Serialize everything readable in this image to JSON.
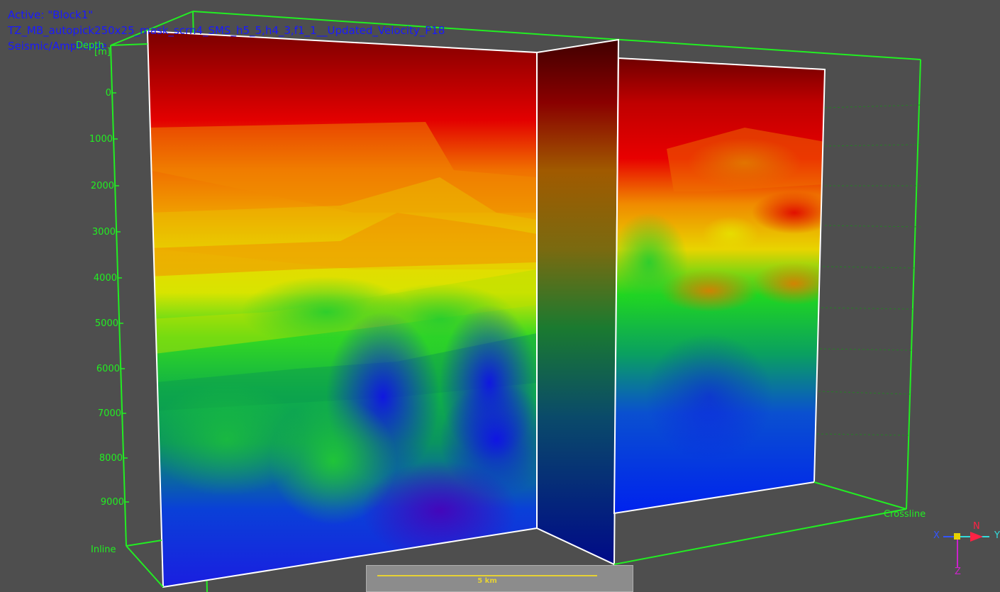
{
  "overlay": {
    "active": "Active: \"Block1\"",
    "dataset": "TZ_MB_autopick250x25_mask_scrn4_SMS_h5_5,h4_3,f1_1__Updated_Velocity_P18",
    "attribute": "Seismic/Amplitude"
  },
  "axes": {
    "depth_label": "Depth",
    "depth_unit": "[m]",
    "depth_ticks": [
      "0",
      "1000",
      "2000",
      "3000",
      "4000",
      "5000",
      "6000",
      "7000",
      "8000",
      "9000"
    ],
    "inline_label": "Inline",
    "crossline_label": "Crossline"
  },
  "scalebar": {
    "label": "5 km"
  },
  "orientation": {
    "x": "X",
    "y": "Y",
    "z": "Z",
    "north": "N",
    "x_color": "#3355ff",
    "y_color": "#33dddd",
    "z_color": "#cc22cc",
    "north_color": "#ff2244"
  },
  "colors": {
    "box": "#22ee22",
    "background": "#4e4e4e",
    "overlay_text": "#1a1aff",
    "colormap": [
      "#6e0000",
      "#e00000",
      "#f07800",
      "#e6dc00",
      "#00d820",
      "#0a9a50",
      "#0018ff",
      "#4400b0"
    ]
  }
}
